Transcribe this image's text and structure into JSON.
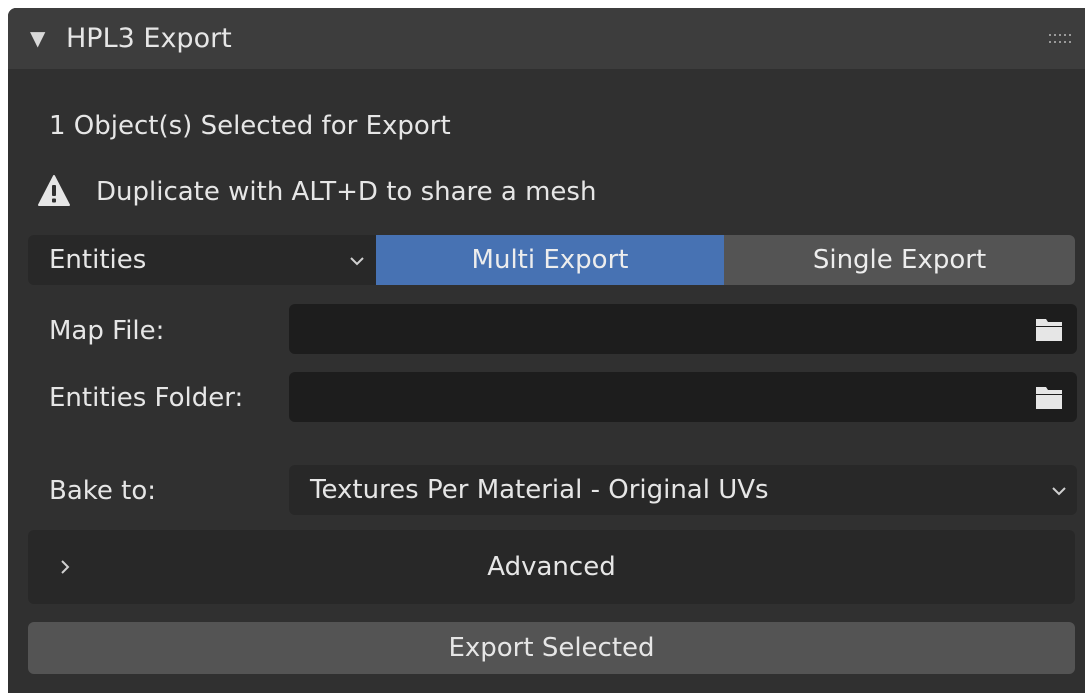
{
  "panel": {
    "title": "HPL3 Export",
    "collapse_icon": "triangle-down-icon",
    "grip_icon": "drag-grip-icon"
  },
  "info": {
    "selection_text": "1 Object(s) Selected for Export",
    "warning_text": "Duplicate with ALT+D to share a mesh",
    "warning_icon": "warning-icon"
  },
  "mode": {
    "dropdown_value": "Entities",
    "segments": [
      "Multi Export",
      "Single Export"
    ],
    "active_segment": "Multi Export"
  },
  "fields": {
    "map_file_label": "Map File:",
    "map_file_value": "",
    "entities_folder_label": "Entities Folder:",
    "entities_folder_value": "",
    "folder_icon": "folder-icon"
  },
  "bake": {
    "label": "Bake to:",
    "value": "Textures Per Material - Original UVs"
  },
  "advanced": {
    "label": "Advanced",
    "expanded": false
  },
  "actions": {
    "export_label": "Export Selected"
  },
  "colors": {
    "panel_bg": "#303030",
    "header_bg": "#3d3d3d",
    "accent": "#4772b3",
    "field_bg": "#1d1d1d",
    "button_bg": "#545454"
  }
}
